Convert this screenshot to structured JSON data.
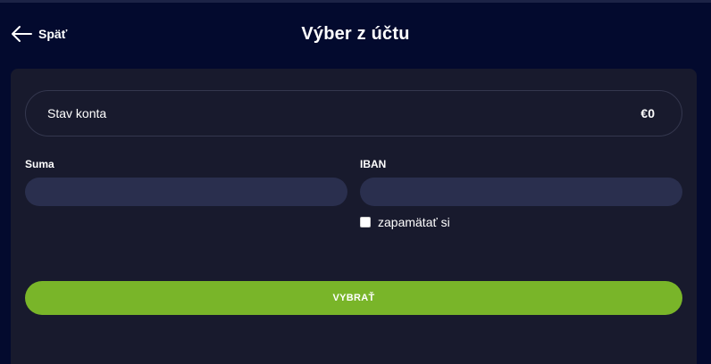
{
  "header": {
    "back_label": "Späť",
    "title": "Výber z účtu",
    "back_icon": "arrow-left-icon"
  },
  "balance": {
    "label": "Stav konta",
    "value": "€0"
  },
  "form": {
    "amount_label": "Suma",
    "amount_value": "",
    "iban_label": "IBAN",
    "iban_value": "",
    "remember_label": "zapamätať si",
    "remember_checked": false,
    "submit_label": "VYBRAŤ"
  },
  "colors": {
    "background": "#030a2e",
    "panel": "#181a2d",
    "input": "#2a2f4e",
    "accent": "#79b529"
  }
}
